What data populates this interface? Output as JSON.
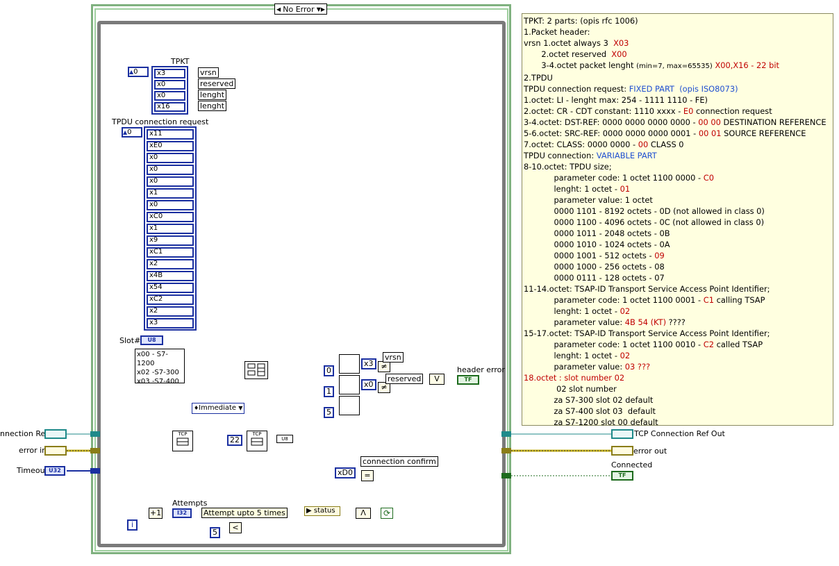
{
  "case_selector": {
    "value": "No Error",
    "arrows": "▼▶",
    "left_arrow": "◀"
  },
  "tpkt": {
    "title": "TPKT",
    "index": "0",
    "elements": [
      "x3",
      "x0",
      "x0",
      "x16"
    ],
    "element_labels": [
      "vrsn",
      "reserved",
      "lenght",
      "lenght"
    ]
  },
  "tpdu": {
    "title": "TPDU connection request",
    "index": "0",
    "elements": [
      "x11",
      "xE0",
      "x0",
      "x0",
      "x0",
      "x1",
      "x0",
      "xC0",
      "x1",
      "x9",
      "xC1",
      "x2",
      "x4B",
      "x54",
      "xC2",
      "x2",
      "x3"
    ]
  },
  "slot": {
    "label": "Slot#",
    "type": "U8",
    "options": [
      "x00 - S7-1200",
      "x02 -S7-300",
      "x03 -S7-400"
    ]
  },
  "immediate": {
    "value": "Immediate",
    "icon": "♦"
  },
  "constants": {
    "c22": "22",
    "c0": "0",
    "c1": "1",
    "c5": "5",
    "cx3": "x3",
    "cx0": "x0",
    "cD0": "xD0",
    "c5b": "5"
  },
  "labels": {
    "vrsn": "vrsn",
    "reserved": "reserved",
    "header_error": "header error",
    "connection_confirm": "connection confirm",
    "attempts": "Attempts",
    "attempt_note": "Attempt upto 5 times",
    "status": "status",
    "iter": "i",
    "attempts_type": "I32",
    "bool_type": "TF",
    "u8_type": "U8",
    "tcp": "TCP"
  },
  "terminals": {
    "conn_ref_in": "nnection Ref",
    "error_in": "error in",
    "timeout": "Timeout",
    "timeout_type": "U32",
    "conn_ref_out": "TCP Connection Ref Out",
    "error_out": "error out",
    "connected": "Connected"
  },
  "note": [
    [
      {
        "t": "TPKT: 2 parts: (opis rfc 1006)"
      }
    ],
    [
      {
        "t": "1.Packet header:"
      }
    ],
    [
      {
        "t": "vrsn 1.octet always 3  "
      },
      {
        "t": "X03",
        "c": "red"
      }
    ],
    [
      {
        "t": "       2.octet reserved  "
      },
      {
        "t": "X00",
        "c": "red"
      }
    ],
    [
      {
        "t": "       3-4.octet packet lenght "
      },
      {
        "t": "(min=7, max=65535)",
        "c": "small"
      },
      {
        "t": " "
      },
      {
        "t": "X00,X16 - 22 bit",
        "c": "red"
      }
    ],
    [
      {
        "t": "2.TPDU"
      }
    ],
    [
      {
        "t": "TPDU connection request: "
      },
      {
        "t": "FIXED PART  (opis ISO8073)",
        "c": "blue"
      }
    ],
    [
      {
        "t": "1.octet: LI - lenght max: 254 - 1111 1110 - FE)"
      }
    ],
    [
      {
        "t": "2.octet: CR - CDT constant: 1110 xxxx - "
      },
      {
        "t": "E0",
        "c": "red"
      },
      {
        "t": " connection request"
      }
    ],
    [
      {
        "t": "3-4.octet: DST-REF: 0000 0000 0000 0000 - "
      },
      {
        "t": "00 00",
        "c": "red"
      },
      {
        "t": " DESTINATION REFERENCE"
      }
    ],
    [
      {
        "t": "5-6.octet: SRC-REF: 0000 0000 0000 0001 - "
      },
      {
        "t": "00 01",
        "c": "red"
      },
      {
        "t": " SOURCE REFERENCE"
      }
    ],
    [
      {
        "t": "7.octet: CLASS: 0000 0000 - "
      },
      {
        "t": "00",
        "c": "red"
      },
      {
        "t": " CLASS 0"
      }
    ],
    [
      {
        "t": "TPDU connection: "
      },
      {
        "t": "VARIABLE PART",
        "c": "blue"
      }
    ],
    [
      {
        "t": "8-10.octet: TPDU size;"
      }
    ],
    [
      {
        "t": "            parameter code: 1 octet 1100 0000 - "
      },
      {
        "t": "C0",
        "c": "red"
      }
    ],
    [
      {
        "t": "            lenght: 1 octet - "
      },
      {
        "t": "01",
        "c": "red"
      }
    ],
    [
      {
        "t": "            parameter value: 1 octet"
      }
    ],
    [
      {
        "t": "            0000 1101 - 8192 octets - 0D (not allowed in class 0)"
      }
    ],
    [
      {
        "t": "            0000 1100 - 4096 octets - 0C (not allowed in class 0)"
      }
    ],
    [
      {
        "t": "            0000 1011 - 2048 octets - 0B"
      }
    ],
    [
      {
        "t": "            0000 1010 - 1024 octets - 0A"
      }
    ],
    [
      {
        "t": "            0000 1001 - 512 octets - "
      },
      {
        "t": "09",
        "c": "red"
      }
    ],
    [
      {
        "t": "            0000 1000 - 256 octets - 08"
      }
    ],
    [
      {
        "t": "            0000 0111 - 128 octets - 07"
      }
    ],
    [
      {
        "t": "11-14.octet: TSAP-ID Transport Service Access Point Identifier;"
      }
    ],
    [
      {
        "t": "            parameter code: 1 octet 1100 0001 - "
      },
      {
        "t": "C1",
        "c": "red"
      },
      {
        "t": " calling TSAP"
      }
    ],
    [
      {
        "t": "            lenght: 1 octet - "
      },
      {
        "t": "02",
        "c": "red"
      }
    ],
    [
      {
        "t": "            parameter value: "
      },
      {
        "t": "4B 54 (KT)",
        "c": "red"
      },
      {
        "t": " ????"
      }
    ],
    [
      {
        "t": "15-17.octet: TSAP-ID Transport Service Access Point Identifier;"
      }
    ],
    [
      {
        "t": "            parameter code: 1 octet 1100 0010 - "
      },
      {
        "t": "C2",
        "c": "red"
      },
      {
        "t": " called TSAP"
      }
    ],
    [
      {
        "t": "            lenght: 1 octet - "
      },
      {
        "t": "02",
        "c": "red"
      }
    ],
    [
      {
        "t": "            parameter value: "
      },
      {
        "t": "03 ???",
        "c": "red"
      }
    ],
    [
      {
        "t": "18.octet : slot number 02",
        "c": "red"
      }
    ],
    [
      {
        "t": "             02 slot number"
      }
    ],
    [
      {
        "t": "            za S7-300 slot 02 default"
      }
    ],
    [
      {
        "t": "            za S7-400 slot 03  default"
      }
    ],
    [
      {
        "t": "            za S7-1200 slot 00 default"
      }
    ]
  ],
  "colors": {
    "cluster_wire": "#1f8a8a",
    "error_wire": "#c9b418",
    "numeric_wire": "#1a2fa0",
    "bool_wire": "#1d6b1d",
    "frame": "#7fb17f"
  }
}
